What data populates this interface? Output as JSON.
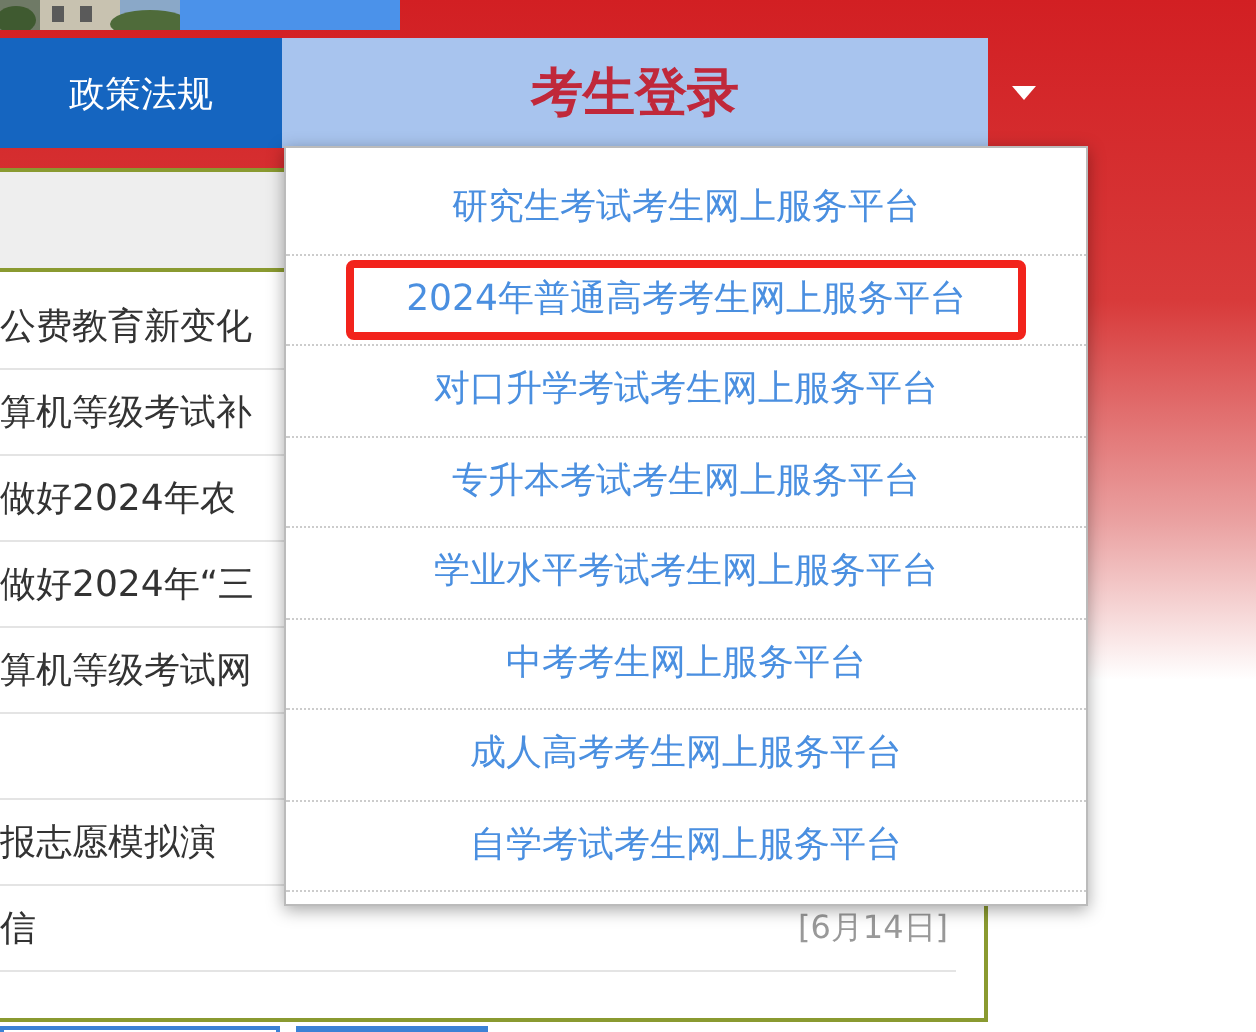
{
  "nav": {
    "items": [
      {
        "label": "政策法规",
        "selected": false
      },
      {
        "label": "考生登录",
        "selected": true
      }
    ]
  },
  "login_menu": {
    "expanded": true,
    "items": [
      {
        "label": "研究生考试考生网上服务平台",
        "highlighted": false
      },
      {
        "label": "2024年普通高考考生网上服务平台",
        "highlighted": true
      },
      {
        "label": "对口升学考试考生网上服务平台",
        "highlighted": false
      },
      {
        "label": "专升本考试考生网上服务平台",
        "highlighted": false
      },
      {
        "label": "学业水平考试考生网上服务平台",
        "highlighted": false
      },
      {
        "label": "中考考生网上服务平台",
        "highlighted": false
      },
      {
        "label": "成人高考考生网上服务平台",
        "highlighted": false
      },
      {
        "label": "自学考试考生网上服务平台",
        "highlighted": false
      }
    ]
  },
  "news": {
    "rows": [
      {
        "title": "公费教育新变化"
      },
      {
        "title": "算机等级考试补"
      },
      {
        "title": "做好2024年农"
      },
      {
        "title": "做好2024年“三"
      },
      {
        "title": "算机等级考试网"
      },
      {
        "blank": true
      },
      {
        "title": "报志愿模拟演"
      },
      {
        "title": "信",
        "date": "[6月14日]"
      }
    ]
  }
}
